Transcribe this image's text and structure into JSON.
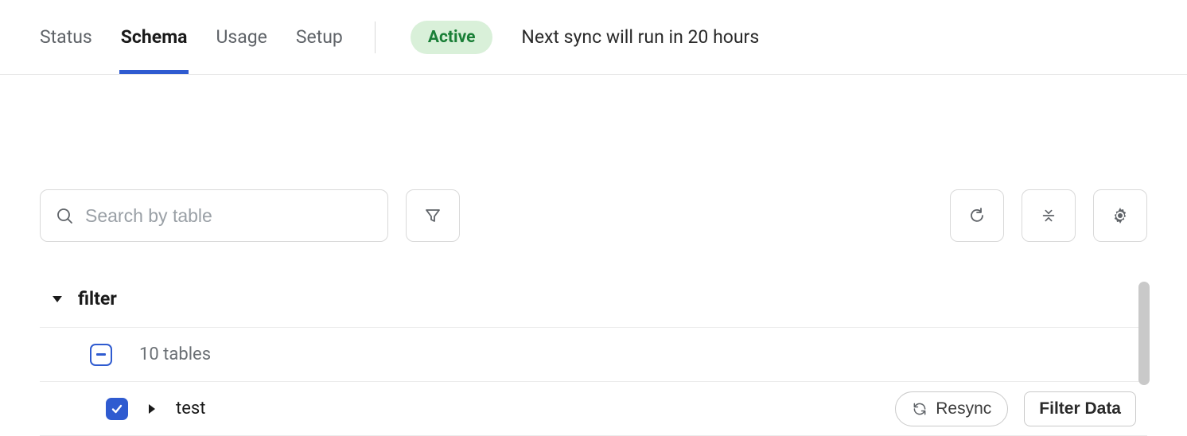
{
  "tabs": {
    "status": "Status",
    "schema": "Schema",
    "usage": "Usage",
    "setup": "Setup",
    "active_tab": "schema"
  },
  "status_pill": "Active",
  "next_sync": "Next sync will run in 20 hours",
  "search": {
    "placeholder": "Search by table",
    "value": ""
  },
  "schema": {
    "name": "filter",
    "table_count_label": "10 tables",
    "tables": [
      {
        "name": "test",
        "checked": true
      }
    ]
  },
  "buttons": {
    "resync": "Resync",
    "filter_data": "Filter Data"
  }
}
